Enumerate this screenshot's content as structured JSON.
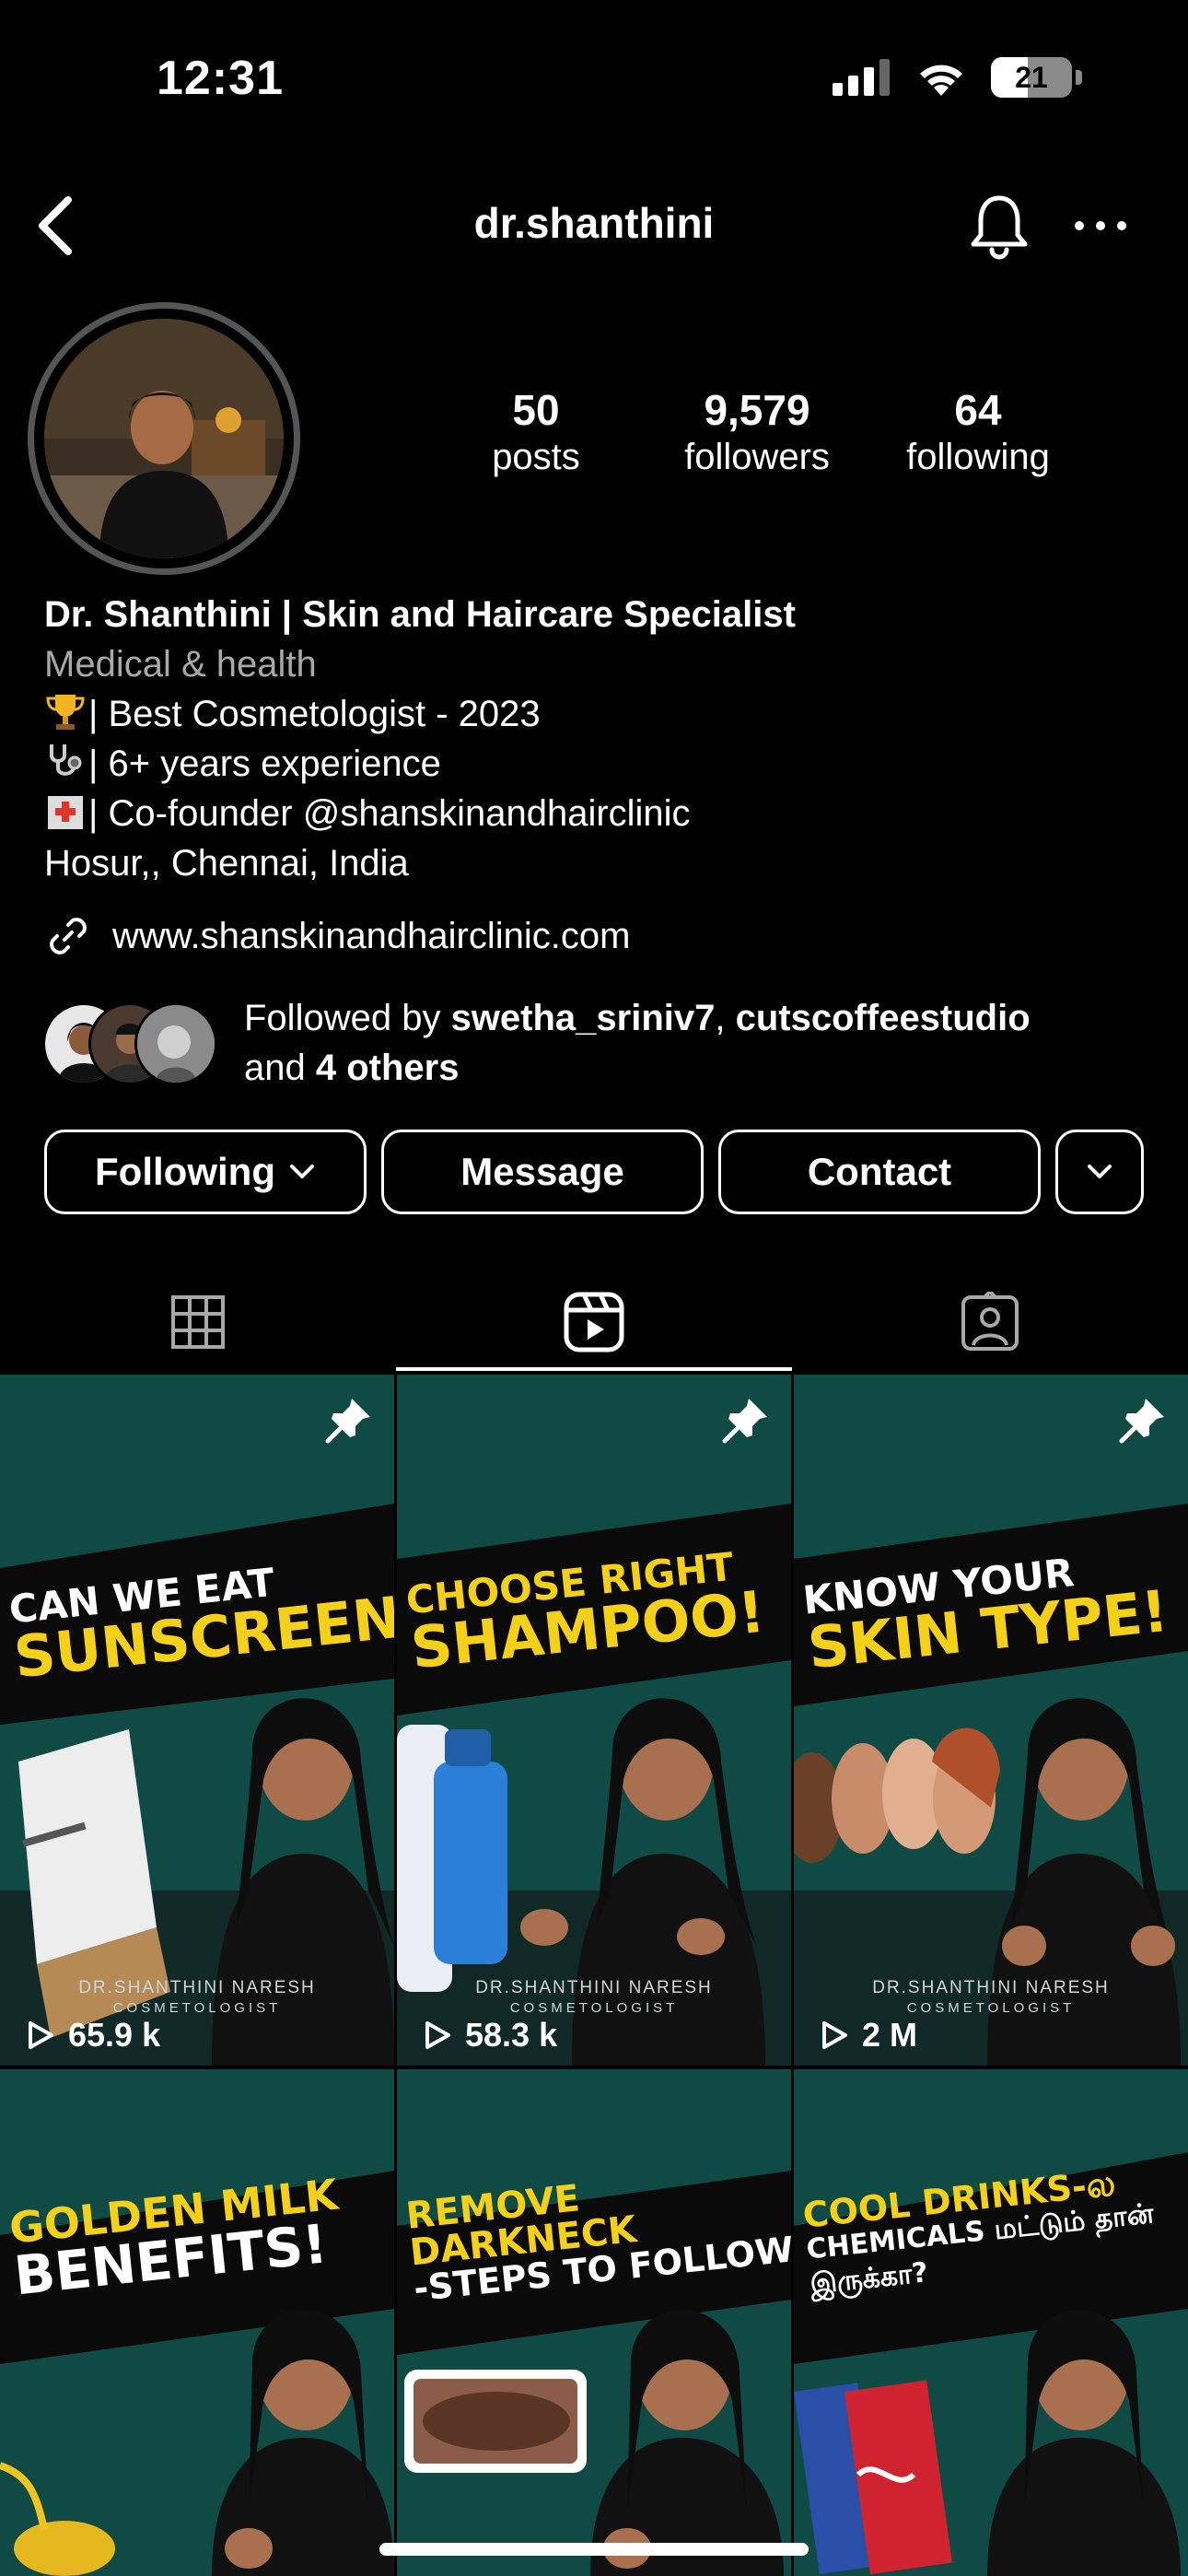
{
  "status": {
    "time": "12:31",
    "battery": "21",
    "battery_level": 0.21
  },
  "header": {
    "username": "dr.shanthini",
    "back_icon": "chevron-left-icon",
    "bell_icon": "bell-icon",
    "more_icon": "more-horizontal-icon"
  },
  "stats": [
    {
      "value": "50",
      "label": "posts"
    },
    {
      "value": "9,579",
      "label": "followers"
    },
    {
      "value": "64",
      "label": "following"
    }
  ],
  "bio": {
    "name": "Dr. Shanthini | Skin and Haircare Specialist",
    "category": "Medical & health",
    "lines": [
      "| Best Cosmetologist - 2023",
      "| 6+ years experience",
      "| Co-founder @shanskinandhairclinic",
      "Hosur,, Chennai, India"
    ],
    "link": "www.shanskinandhairclinic.com"
  },
  "followed_by": {
    "prefix": "Followed by ",
    "user1": "swetha_sriniv7",
    "sep": ", ",
    "user2": "cutscoffeestudio",
    "and": "and ",
    "others": "4 others"
  },
  "buttons": {
    "following": "Following",
    "message": "Message",
    "contact": "Contact"
  },
  "tabs": [
    "grid-icon",
    "reels-icon",
    "tagged-icon"
  ],
  "reels": [
    {
      "line1": "CAN WE EAT",
      "line2": "SUNSCREEN?",
      "views": "65.9 k",
      "pinned": true,
      "credit": "DR.SHANTHINI NARESH",
      "credit_sub": "COSMETOLOGIST"
    },
    {
      "line1": "CHOOSE RIGHT",
      "line2": "SHAMPOO!",
      "views": "58.3 k",
      "pinned": true,
      "credit": "DR.SHANTHINI NARESH",
      "credit_sub": "COSMETOLOGIST"
    },
    {
      "line1": "KNOW YOUR",
      "line2": "SKIN TYPE!",
      "views": "2 M",
      "pinned": true,
      "credit": "DR.SHANTHINI NARESH",
      "credit_sub": "COSMETOLOGIST"
    },
    {
      "line1": "GOLDEN MILK",
      "line2": "BENEFITS!",
      "views": "",
      "pinned": false
    },
    {
      "line1": "REMOVE DARKNECK",
      "line2": "-STEPS TO FOLLOW",
      "views": "",
      "pinned": false
    },
    {
      "line1": "COOL DRINKS-ல",
      "line2": "CHEMICALS மட்டும் தான் இருக்கா?",
      "views": "",
      "pinned": false
    }
  ]
}
